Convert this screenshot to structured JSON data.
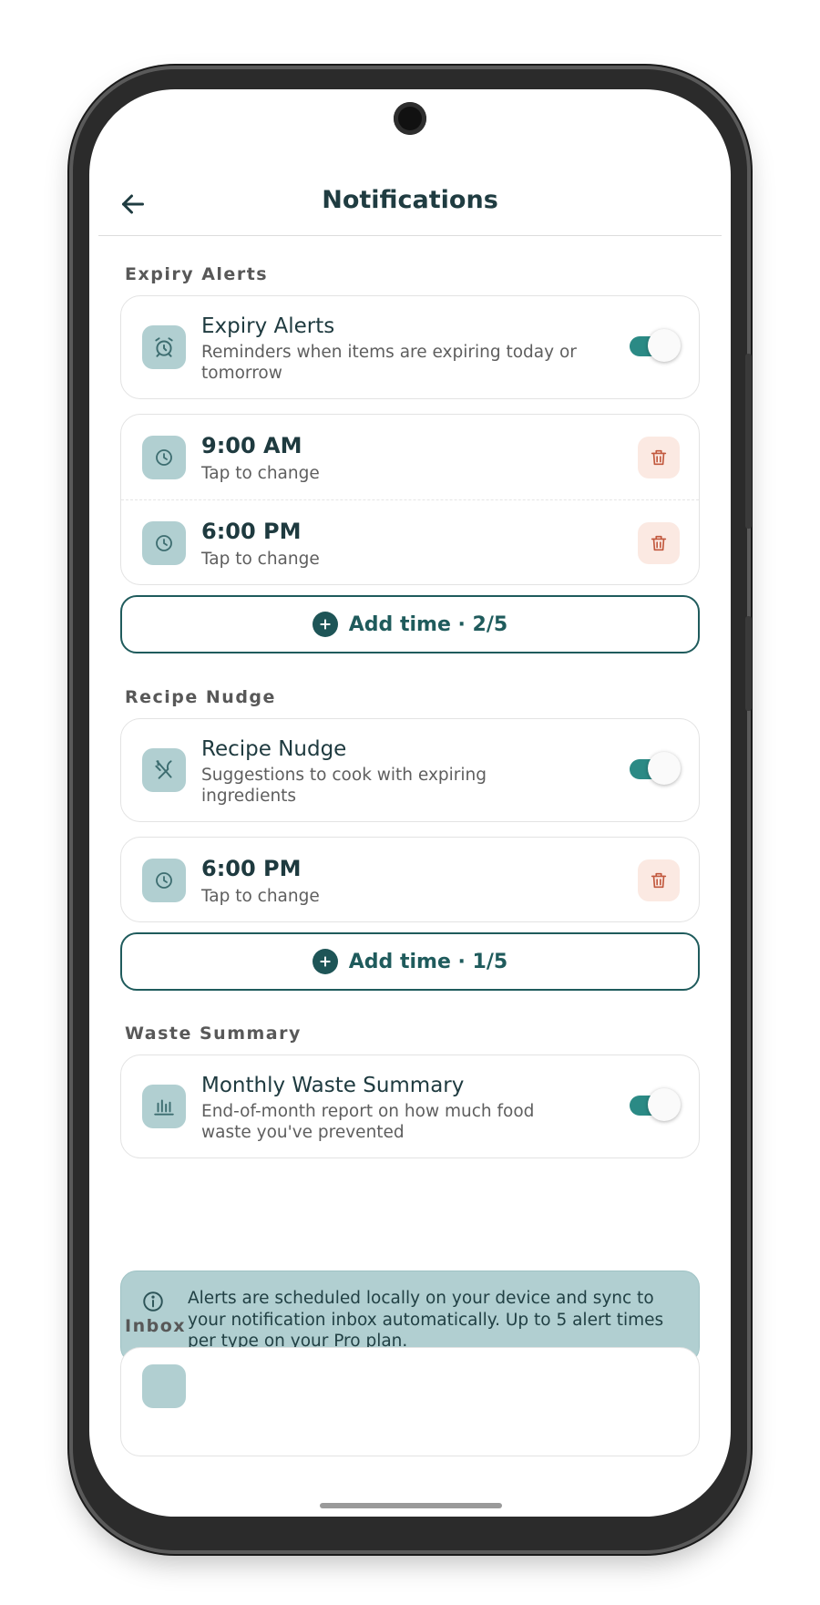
{
  "header": {
    "title": "Notifications"
  },
  "expiry": {
    "section_label": "Expiry Alerts",
    "toggle_title": "Expiry Alerts",
    "toggle_sub": "Reminders when items are expiring today or tomorrow",
    "enabled": true,
    "times": [
      {
        "time": "9:00 AM",
        "sub": "Tap to change"
      },
      {
        "time": "6:00 PM",
        "sub": "Tap to change"
      }
    ],
    "add_label": "Add time · 2/5"
  },
  "recipe": {
    "section_label": "Recipe Nudge",
    "toggle_title": "Recipe Nudge",
    "toggle_sub": "Suggestions to cook with expiring ingredients",
    "enabled": true,
    "times": [
      {
        "time": "6:00 PM",
        "sub": "Tap to change"
      }
    ],
    "add_label": "Add time · 1/5"
  },
  "waste": {
    "section_label": "Waste Summary",
    "toggle_title": "Monthly Waste Summary",
    "toggle_sub": "End-of-month report on how much food waste you've prevented",
    "enabled": true
  },
  "info": {
    "text": "Alerts are scheduled locally on your device and sync to your notification inbox automatically. Up to 5 alert times per type on your Pro plan."
  },
  "inbox": {
    "section_label": "Inbox"
  },
  "icons": {
    "back": "arrow-left-icon",
    "alarm": "alarm-clock-icon",
    "clock": "clock-icon",
    "trash": "trash-icon",
    "utensils": "utensils-crossed-icon",
    "chart": "bar-chart-icon",
    "plus": "plus-circle-icon",
    "info": "info-icon"
  },
  "colors": {
    "accent": "#2b8a85",
    "dark_teal": "#1f5b5c",
    "icon_bg": "#b1cfd1",
    "danger": "#c2593e",
    "danger_bg": "#fbe9e2"
  }
}
